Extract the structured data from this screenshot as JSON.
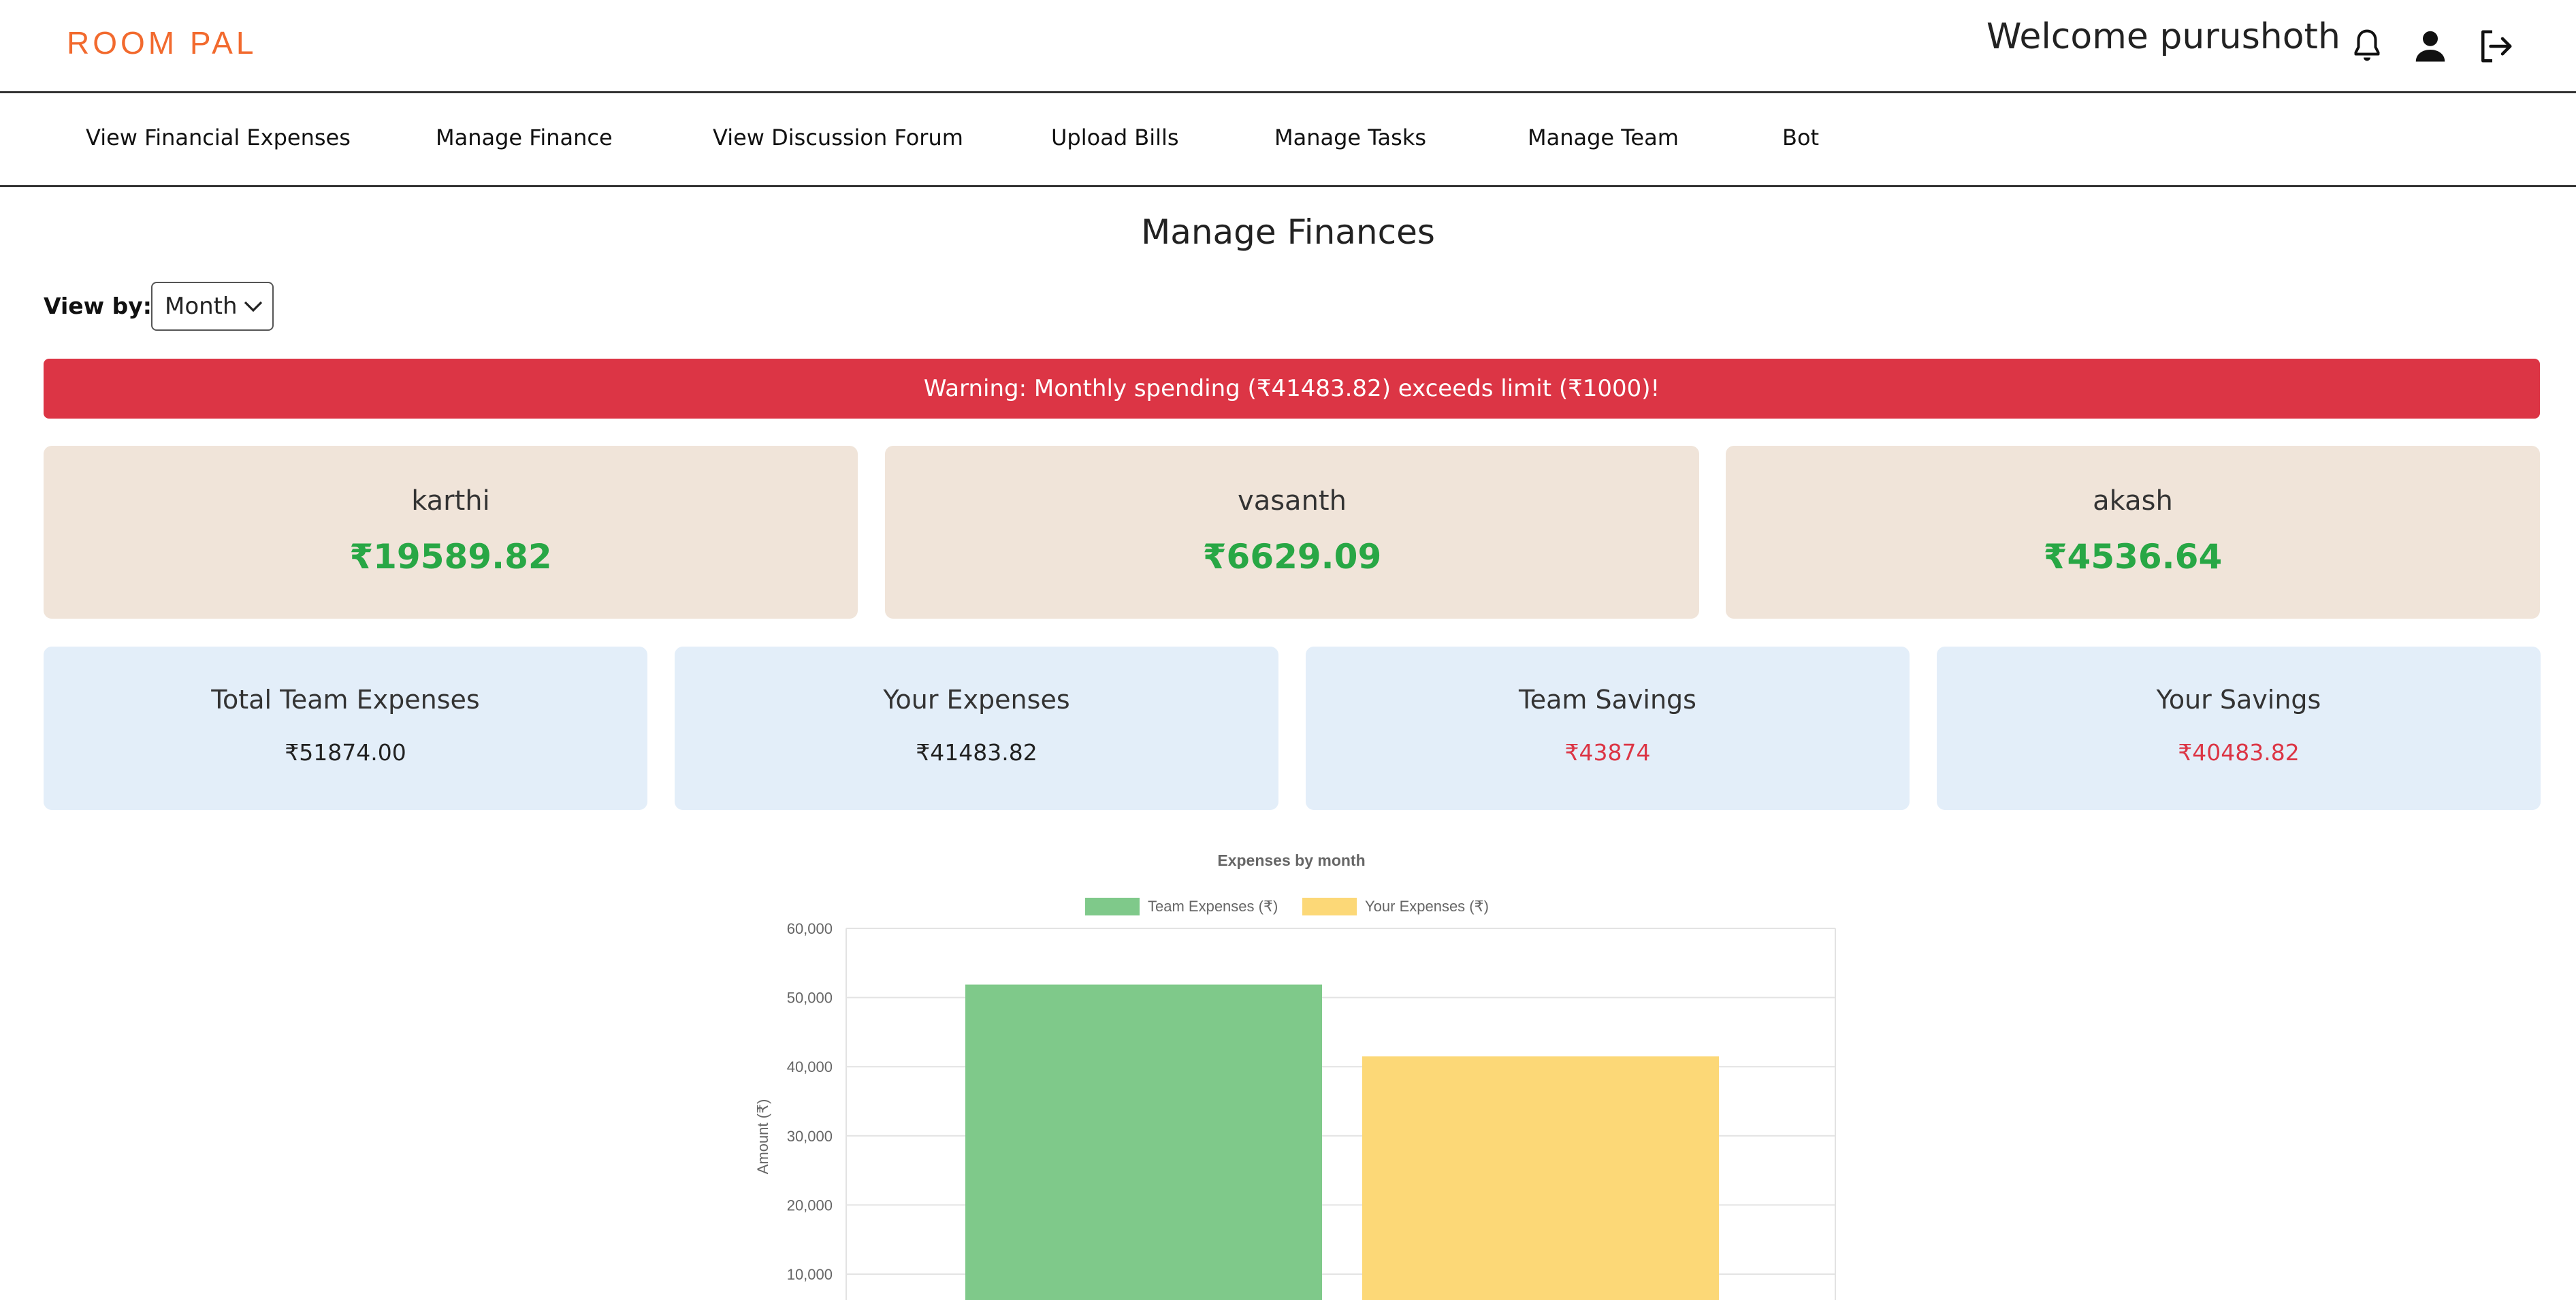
{
  "header": {
    "brand": "ROOM PAL",
    "welcome": "Welcome purushoth",
    "icons": [
      "bell-icon",
      "user-icon",
      "logout-icon"
    ]
  },
  "nav": {
    "items": [
      "View Financial Expenses",
      "Manage Finance",
      "View Discussion Forum",
      "Upload Bills",
      "Manage Tasks",
      "Manage Team",
      "Bot"
    ]
  },
  "page": {
    "title": "Manage Finances",
    "view_by_label": "View by:",
    "view_by_value": "Month",
    "warning": "Warning: Monthly spending (₹41483.82) exceeds limit (₹1000)!"
  },
  "members": [
    {
      "name": "karthi",
      "amount": "₹19589.82"
    },
    {
      "name": "vasanth",
      "amount": "₹6629.09"
    },
    {
      "name": "akash",
      "amount": "₹4536.64"
    }
  ],
  "summary": [
    {
      "title": "Total Team Expenses",
      "value": "₹51874.00"
    },
    {
      "title": "Your Expenses",
      "value": "₹41483.82"
    },
    {
      "title": "Team Savings",
      "value": "₹43874"
    },
    {
      "title": "Your Savings",
      "value": "₹40483.82"
    }
  ],
  "colors": {
    "brand": "#f26a2e",
    "warning": "#dc3545",
    "positive": "#28a745",
    "member_card_bg": "#f0e4d9",
    "summary_card_bg": "#e3eef9"
  },
  "chart_data": {
    "type": "bar",
    "title": "Expenses by month",
    "ylabel": "Amount (₹)",
    "xlabel": "",
    "ylim": [
      0,
      60000
    ],
    "y_ticks": [
      "60,000",
      "50,000",
      "40,000",
      "30,000",
      "20,000",
      "10,000"
    ],
    "grid": true,
    "legend_position": "top",
    "categories": [
      ""
    ],
    "series": [
      {
        "name": "Team Expenses (₹)",
        "values": [
          51874.0
        ],
        "color": "#7fc98a"
      },
      {
        "name": "Your Expenses (₹)",
        "values": [
          41483.82
        ],
        "color": "#fcd877"
      }
    ]
  }
}
